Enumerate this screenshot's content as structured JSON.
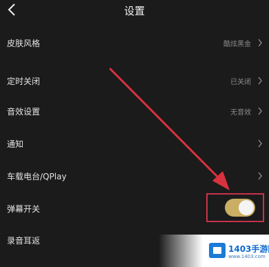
{
  "header": {
    "title": "设置"
  },
  "rows": [
    {
      "label": "皮肤风格",
      "value": "酷炫黑金"
    },
    {
      "label": "定时关闭",
      "value": "已关闭"
    },
    {
      "label": "音效设置",
      "value": "无音效"
    },
    {
      "label": "通知",
      "value": ""
    },
    {
      "label": "车载电台/QPlay",
      "value": ""
    },
    {
      "label": "弹幕开关",
      "value": ""
    },
    {
      "label": "录音耳返",
      "value": ""
    }
  ],
  "danmaku_toggle": {
    "on": true
  },
  "colors": {
    "background": "#1b1b1b",
    "toggle_on": "#c9ae63",
    "annotation": "#d8323f"
  },
  "watermark": {
    "text": "1403手游网",
    "sub": "www.1403.com"
  }
}
